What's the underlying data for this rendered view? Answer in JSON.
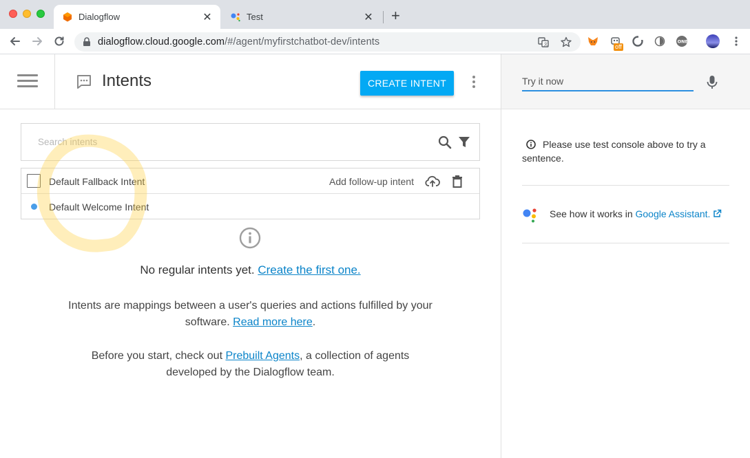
{
  "browser": {
    "tabs": [
      {
        "title": "Dialogflow",
        "favicon": "dialogflow-icon",
        "active": true
      },
      {
        "title": "Test",
        "favicon": "google-assistant-icon",
        "active": false
      }
    ],
    "url_host": "dialogflow.cloud.google.com",
    "url_path": "/#/agent/myfirstchatbot-dev/intents",
    "extension_badge": "off"
  },
  "header": {
    "title": "Intents",
    "create_button": "CREATE INTENT"
  },
  "search": {
    "placeholder": "Search intents"
  },
  "intents": [
    {
      "name": "Default Fallback Intent",
      "follow_up": "Add follow-up intent"
    },
    {
      "name": "Default Welcome Intent"
    }
  ],
  "empty_state": {
    "line1_text": "No regular intents yet.",
    "line1_link": "Create the first one.",
    "line2_text": "Intents are mappings between a user's queries and actions fulfilled by your software.",
    "line2_link": "Read more here",
    "line2_end": ".",
    "line3_start": "Before you start, check out",
    "line3_link": "Prebuilt Agents",
    "line3_end": ", a collection of agents developed by the Dialogflow team."
  },
  "test_panel": {
    "try_placeholder": "Try it now",
    "tip": "Please use test console above to try a sentence.",
    "assistant_text": "See how it works in",
    "assistant_link": "Google Assistant."
  },
  "colors": {
    "accent": "#03a9f4",
    "link": "#0b84c9",
    "welcome_dot": "#4a9ee8"
  }
}
